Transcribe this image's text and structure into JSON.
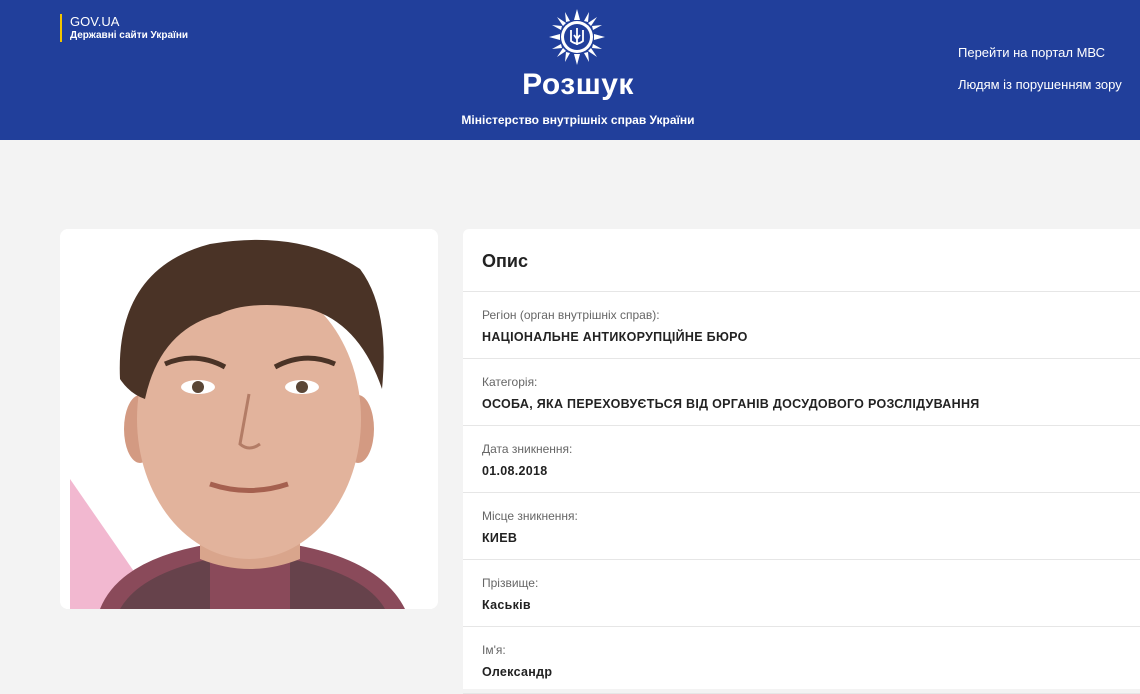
{
  "header": {
    "govua_domain": "GOV.UA",
    "govua_subtitle": "Державні сайти України",
    "title": "Розшук",
    "subtitle": "Міністерство внутрішніх справ України",
    "links": [
      "Перейти на портал МВС",
      "Людям із порушенням зору"
    ],
    "background_color": "#213f9b",
    "accent_color": "#f2c500",
    "emblem_icon": "police-star-trident-icon"
  },
  "photo": {
    "icon": "person-photo"
  },
  "description": {
    "title": "Опис",
    "fields": [
      {
        "label": "Регіон (орган внутрішніх справ):",
        "value": "НАЦІОНАЛЬНЕ АНТИКОРУПЦІЙНЕ БЮРО"
      },
      {
        "label": "Категорія:",
        "value": "ОСОБА, ЯКА ПЕРЕХОВУЄТЬСЯ ВІД ОРГАНІВ ДОСУДОВОГО РОЗСЛІДУВАННЯ"
      },
      {
        "label": "Дата зникнення:",
        "value": "01.08.2018"
      },
      {
        "label": "Місце зникнення:",
        "value": "КИЕВ"
      },
      {
        "label": "Прізвище:",
        "value": "Каськів"
      },
      {
        "label": "Ім'я:",
        "value": "Олександр"
      }
    ]
  }
}
